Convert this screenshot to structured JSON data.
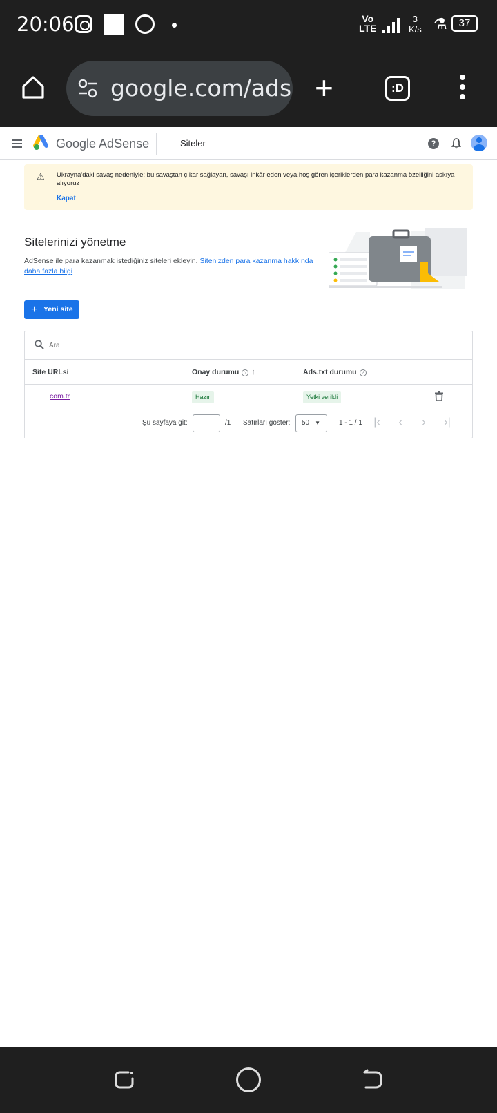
{
  "status_bar": {
    "time": "20:06",
    "network": "Vo\nLTE",
    "speed": "3\nK/s",
    "battery": "37"
  },
  "browser": {
    "url": "google.com/adse",
    "tabs_label": ":D"
  },
  "app": {
    "brand": "Google AdSense",
    "page_name": "Siteler",
    "help_label": "?"
  },
  "banner": {
    "message": "Ukrayna'daki savaş nedeniyle; bu savaştan çıkar sağlayan, savaşı inkâr eden veya hoş gören içeriklerden para kazanma özelliğini askıya alıyoruz",
    "close_label": "Kapat"
  },
  "main": {
    "title": "Sitelerinizi yönetme",
    "description": "AdSense ile para kazanmak istediğiniz siteleri ekleyin.",
    "link_text": "Sitenizden para kazanma hakkında daha fazla bilgi",
    "new_site_label": "Yeni site"
  },
  "table": {
    "search_placeholder": "Ara",
    "columns": [
      "Site URLsi",
      "Onay durumu",
      "Ads.txt durumu"
    ],
    "rows": [
      {
        "site": "com.tr",
        "approval": "Hazır",
        "ads_txt": "Yetki verildi"
      }
    ],
    "pager": {
      "goto_label": "Şu sayfaya git:",
      "of_total": "/1",
      "rows_label": "Satırları göster:",
      "rows_per_page": "50",
      "range": "1 - 1 / 1"
    }
  },
  "colors": {
    "accent": "#1a73e8",
    "banner_bg": "#fef7e0",
    "chip_bg": "#e6f4ea",
    "chip_text": "#137333",
    "chrome_bg": "#1f1f1f"
  }
}
